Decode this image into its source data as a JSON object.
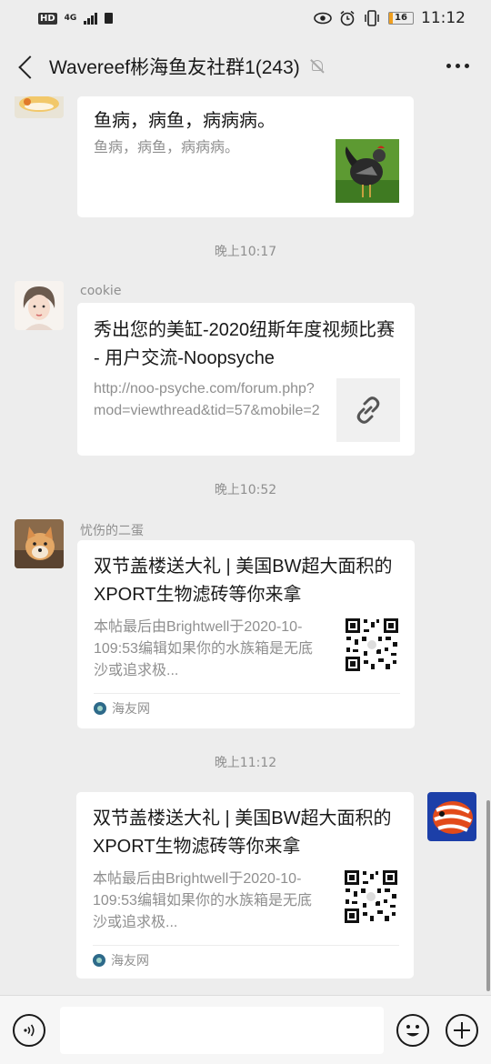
{
  "status_bar": {
    "hd": "HD",
    "network": "4G",
    "battery": "16",
    "battery_percent": 16,
    "time": "11:12"
  },
  "header": {
    "title": "Wavereef彬海鱼友社群1(243)",
    "back_icon": "chevron-left-icon",
    "mute_icon": "bell-muted-icon",
    "more_icon": "more-dots-icon"
  },
  "messages": {
    "msg1": {
      "title": "鱼病，病鱼，病病病。",
      "desc": "鱼病，病鱼，病病病。"
    },
    "ts1": "晚上10:17",
    "msg2": {
      "sender": "cookie",
      "title": "秀出您的美缸-2020纽斯年度视频比赛 - 用户交流-Noopsyche",
      "desc": "http://noo-psyche.com/forum.php?mod=viewthread&tid=57&mobile=2",
      "thumb_icon": "link-icon"
    },
    "ts2": "晚上10:52",
    "msg3": {
      "sender": "忧伤的二蛋",
      "title": "双节盖楼送大礼 | 美国BW超大面积的XPORT生物滤砖等你来拿",
      "desc": "本帖最后由Brightwell于2020-10-109:53编辑如果你的水族箱是无底沙或追求极...",
      "source": "海友网"
    },
    "ts3": "晚上11:12",
    "msg4": {
      "title": "双节盖楼送大礼 | 美国BW超大面积的XPORT生物滤砖等你来拿",
      "desc": "本帖最后由Brightwell于2020-10-109:53编辑如果你的水族箱是无底沙或追求极...",
      "source": "海友网"
    }
  },
  "input_bar": {
    "voice_icon": "voice-icon",
    "emoji_icon": "emoji-icon",
    "plus_icon": "plus-icon",
    "placeholder": ""
  },
  "colors": {
    "background": "#ededed",
    "card": "#ffffff",
    "muted_text": "#8f8f8f"
  }
}
